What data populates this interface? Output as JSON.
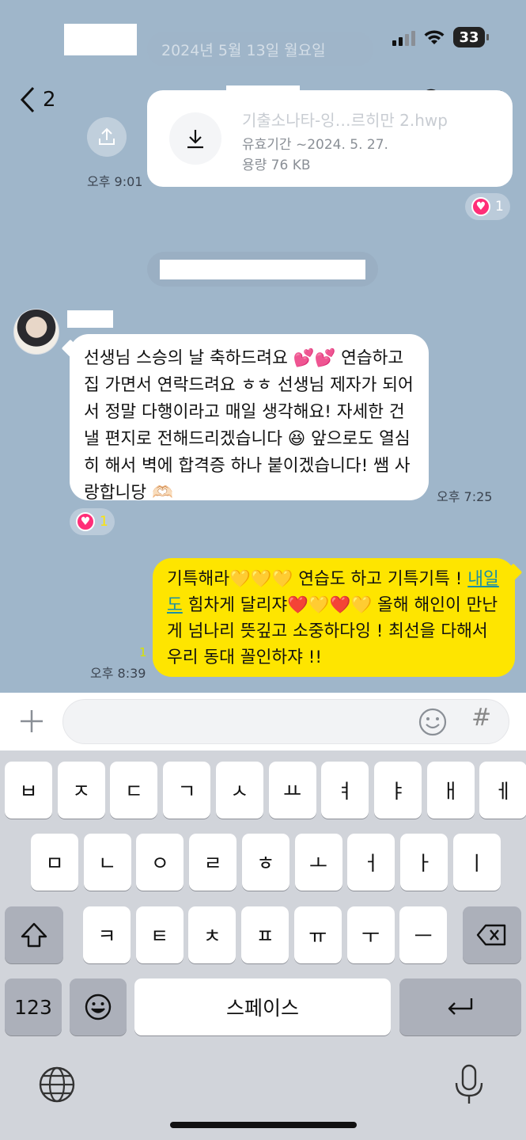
{
  "date_banner": "2024년 5월 13일 월요일",
  "battery": "33",
  "header": {
    "back_count": "2"
  },
  "file": {
    "name": "기출소나타-잉…르히만 2.hwp",
    "expiry": "유효기간  ~2024. 5. 27.",
    "size": "용량  76 KB",
    "time": "오후 9:01",
    "reaction_count": "1"
  },
  "message_in": {
    "text": "선생님 스승의 날 축하드려요 💕💕 연습하고 집 가면서 연락드려요 ㅎㅎ 선생님 제자가 되어서 정말 다행이라고 매일 생각해요! 자세한 건 낼 편지로 전해드리겠습니다 😆 앞으로도 열심히 해서 벽에 합격증 하나 붙이겠습니다! 쌤 사랑합니당 🫶🏻",
    "time": "오후 7:25",
    "reaction_count": "1"
  },
  "message_out": {
    "text_before_link": "기특해라💛💛💛 연습도 하고 기특기특 ! ",
    "link": "내일도",
    "text_after_link": " 힘차게 달리쟈❤️💛❤️💛 올해 해인이 만난게 넘나리 뜻깊고 소중하다잉 ! 최선을 다해서 우리 동대 꼴인하쟈 !!",
    "read_count": "1",
    "time": "오후 8:39"
  },
  "keyboard": {
    "row1": [
      "ㅂ",
      "ㅈ",
      "ㄷ",
      "ㄱ",
      "ㅅ",
      "ㅛ",
      "ㅕ",
      "ㅑ",
      "ㅐ",
      "ㅔ"
    ],
    "row2": [
      "ㅁ",
      "ㄴ",
      "ㅇ",
      "ㄹ",
      "ㅎ",
      "ㅗ",
      "ㅓ",
      "ㅏ",
      "ㅣ"
    ],
    "row3": [
      "ㅋ",
      "ㅌ",
      "ㅊ",
      "ㅍ",
      "ㅠ",
      "ㅜ",
      "ㅡ"
    ],
    "numbers_label": "123",
    "space_label": "스페이스"
  }
}
